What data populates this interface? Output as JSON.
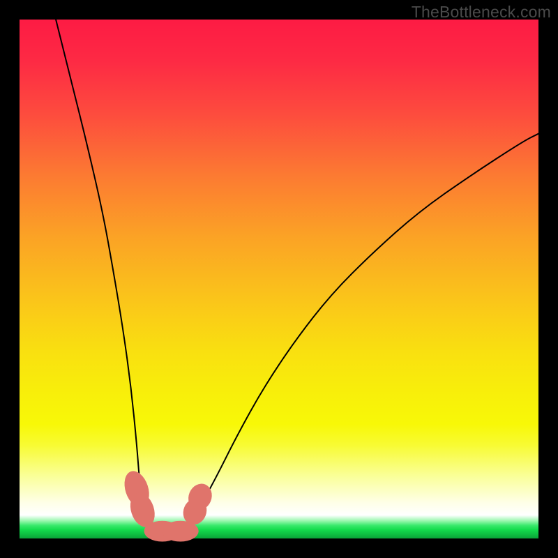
{
  "watermark": "TheBottleneck.com",
  "colors": {
    "frame": "#000000",
    "gradient_top": "#fd1b44",
    "gradient_bottom": "#0aa338",
    "curve_stroke": "#000000",
    "marker_fill": "#e0746b"
  },
  "chart_data": {
    "type": "line",
    "title": "",
    "xlabel": "",
    "ylabel": "",
    "xlim": [
      0,
      100
    ],
    "ylim": [
      0,
      100
    ],
    "left_curve": {
      "x": [
        7,
        10,
        13,
        16,
        18,
        20,
        21.5,
        22.6,
        23.2,
        24,
        25,
        26,
        27.5,
        29
      ],
      "y": [
        100,
        88,
        76,
        63,
        52,
        40,
        29,
        18,
        10,
        6,
        3,
        1.5,
        0.8,
        0.5
      ]
    },
    "right_curve": {
      "x": [
        29,
        31,
        33,
        35,
        38,
        42,
        47,
        53,
        60,
        68,
        77,
        87,
        97,
        100
      ],
      "y": [
        0.5,
        1.2,
        3,
        6.5,
        12,
        20,
        29,
        38,
        47,
        55,
        63,
        70,
        76.5,
        78
      ]
    },
    "markers": [
      {
        "x": 22.6,
        "y": 9.5,
        "rx": 2.2,
        "ry": 3.6,
        "rot": -18
      },
      {
        "x": 23.7,
        "y": 5.5,
        "rx": 2.2,
        "ry": 3.4,
        "rot": -18
      },
      {
        "x": 27.5,
        "y": 1.4,
        "rx": 3.5,
        "ry": 2.0,
        "rot": 0
      },
      {
        "x": 31.0,
        "y": 1.4,
        "rx": 3.5,
        "ry": 2.0,
        "rot": 0
      },
      {
        "x": 33.8,
        "y": 5.2,
        "rx": 2.2,
        "ry": 2.6,
        "rot": 22
      },
      {
        "x": 34.8,
        "y": 8.0,
        "rx": 2.2,
        "ry": 2.6,
        "rot": 22
      }
    ]
  }
}
